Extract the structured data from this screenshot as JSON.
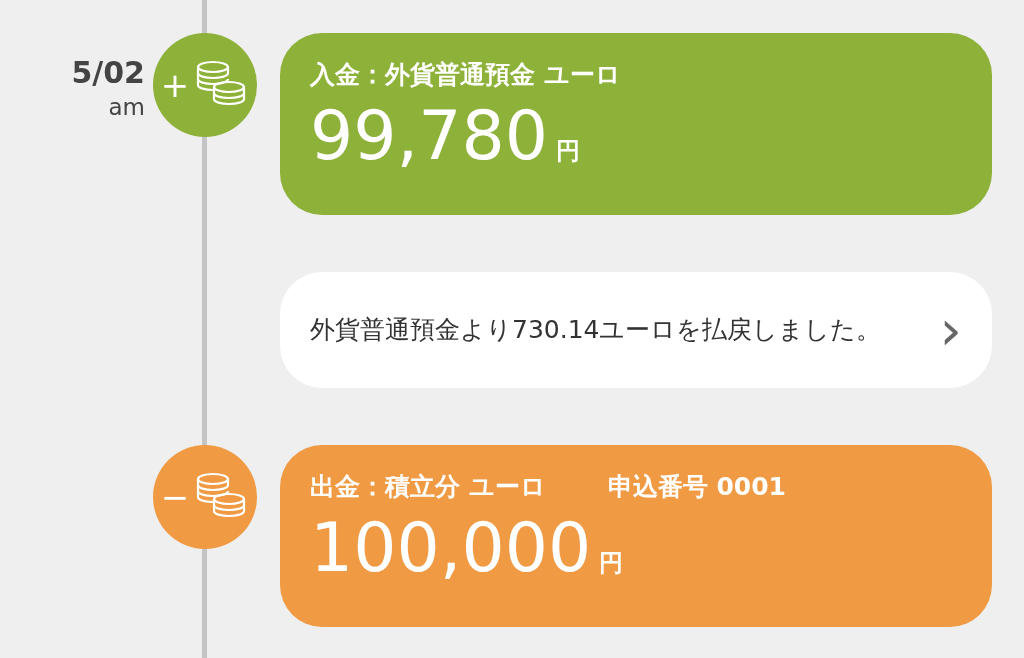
{
  "entries": [
    {
      "kind": "transaction",
      "date": "5/02",
      "period": "am",
      "sign": "+",
      "color": "#8db139",
      "title": "入金：外貨普通預金 ユーロ",
      "amount": "99,780",
      "unit": "円"
    },
    {
      "kind": "notice",
      "text": "外貨普通預金より730.14ユーロを払戻しました。",
      "chevron": "›"
    },
    {
      "kind": "transaction",
      "sign": "−",
      "color": "#f09a44",
      "title": "出金：積立分 ユーロ",
      "reference": "申込番号 0001",
      "amount": "100,000",
      "unit": "円"
    }
  ]
}
